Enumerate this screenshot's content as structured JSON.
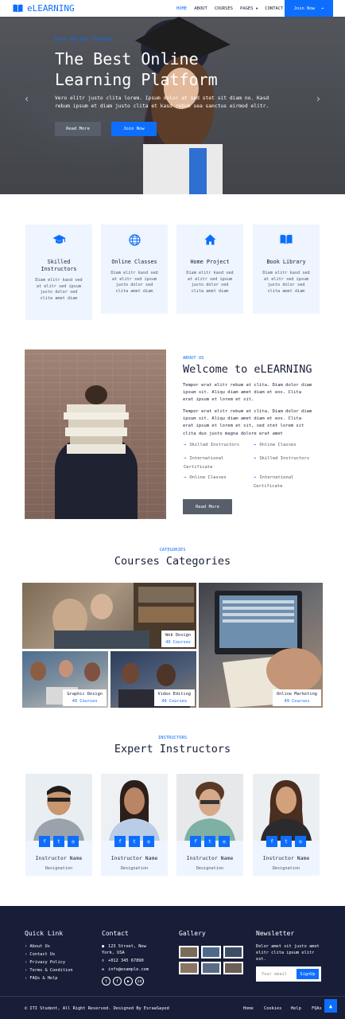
{
  "brand": {
    "name": "eLEARNING"
  },
  "nav": {
    "items": [
      "HOME",
      "ABOUT",
      "COURSES",
      "PAGES",
      "CONTACT"
    ],
    "join_label": "Join Now",
    "arrow": "→"
  },
  "hero": {
    "eyebrow": "Best Online Courses",
    "title_line1": "The Best Online",
    "title_line2": "Learning Platform",
    "text": "Vero elitr justo clita lorem. Ipsum dolor at sed stet sit diam no. Kasd rebum ipsum et diam justo clita et kasd rebum sea sanctus eirmod elitr.",
    "read_label": "Read More",
    "join_label": "Join Now",
    "prev": "‹",
    "next": "›"
  },
  "services": [
    {
      "icon": "graduation-cap-icon",
      "title": "Skilled Instructors",
      "text": "Diam elitr kasd sed at elitr sed ipsum justo dolor sed clita amet diam"
    },
    {
      "icon": "globe-icon",
      "title": "Online Classes",
      "text": "Diam elitr kasd sed at elitr sed ipsum justo dolor sed clita amet diam"
    },
    {
      "icon": "home-icon",
      "title": "Home Project",
      "text": "Diam elitr kasd sed at elitr sed ipsum justo dolor sed clita amet diam"
    },
    {
      "icon": "book-open-icon",
      "title": "Book Library",
      "text": "Diam elitr kasd sed at elitr sed ipsum justo dolor sed clita amet diam"
    }
  ],
  "about": {
    "eyebrow": "ABOUT US",
    "title": "Welcome to eLEARNING",
    "p1": "Tempor erat elitr rebum at clita. Diam dolor diam ipsum sit. Aliqu diam amet diam et eos. Clita erat ipsum et lorem et sit.",
    "p2": "Tempor erat elitr rebum at clita. Diam dolor diam ipsum sit. Aliqu diam amet diam et eos. Clita erat ipsum et lorem et sit, sed stet lorem sit clita duo justo magna dolore erat amet",
    "checks": [
      "Skilled Instructors",
      "Online Classes",
      "International Certificate",
      "Skilled Instructors",
      "Online Classes",
      "International Certificate"
    ],
    "button": "Read More"
  },
  "categories": {
    "eyebrow": "CATEGORIES",
    "title": "Courses Categories",
    "items": [
      {
        "name": "Web Design",
        "count": "49 Courses"
      },
      {
        "name": "Graphic Design",
        "count": "49 Courses"
      },
      {
        "name": "Video Editing",
        "count": "49 Courses"
      },
      {
        "name": "Online Marketing",
        "count": "49 Courses"
      }
    ]
  },
  "team": {
    "eyebrow": "INSTRUCTORS",
    "title": "Expert Instructors",
    "members": [
      {
        "name": "Instructor Name",
        "role": "Designation"
      },
      {
        "name": "Instructor Name",
        "role": "Designation"
      },
      {
        "name": "Instructor Name",
        "role": "Designation"
      },
      {
        "name": "Instructor Name",
        "role": "Designation"
      }
    ]
  },
  "footer": {
    "quick_title": "Quick Link",
    "quick_links": [
      "About Us",
      "Contact Us",
      "Privacy Policy",
      "Terms & Condition",
      "FAQs & Help"
    ],
    "contact_title": "Contact",
    "address": "123 Street, New York, USA",
    "phone": "+012 345 67890",
    "email": "info@example.com",
    "gallery_title": "Gallery",
    "newsletter_title": "Newsletter",
    "newsletter_text": "Dolor amet sit justo amet elitr clita ipsum elitr est.",
    "email_placeholder": "Your email",
    "signup": "SignUp",
    "copyright": "© ITI Student, All Right Reserved. Designed By EsraaSayed",
    "menu": [
      "Home",
      "Cookies",
      "Help",
      "FQAs"
    ],
    "back_top": "▲"
  }
}
